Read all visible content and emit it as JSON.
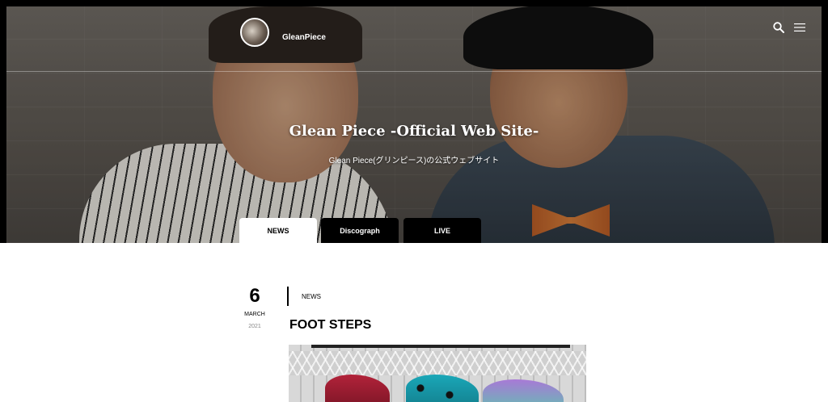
{
  "header": {
    "site_name": "GleanPiece",
    "search_icon": "search-icon",
    "menu_icon": "hamburger-menu-icon"
  },
  "hero": {
    "title": "Glean Piece -Official Web Site-",
    "subtitle": "Glean Piece(グリンピース)の公式ウェブサイト"
  },
  "tabs": [
    {
      "label": "NEWS",
      "active": true
    },
    {
      "label": "Discograph",
      "active": false
    },
    {
      "label": "LIVE",
      "active": false
    }
  ],
  "post": {
    "day": "6",
    "month": "MARCH",
    "year": "2021",
    "category": "NEWS",
    "title": "FOOT STEPS"
  },
  "colors": {
    "tab_active_bg": "#ffffff",
    "tab_inactive_bg": "#000000",
    "page_bg": "#ffffff"
  }
}
